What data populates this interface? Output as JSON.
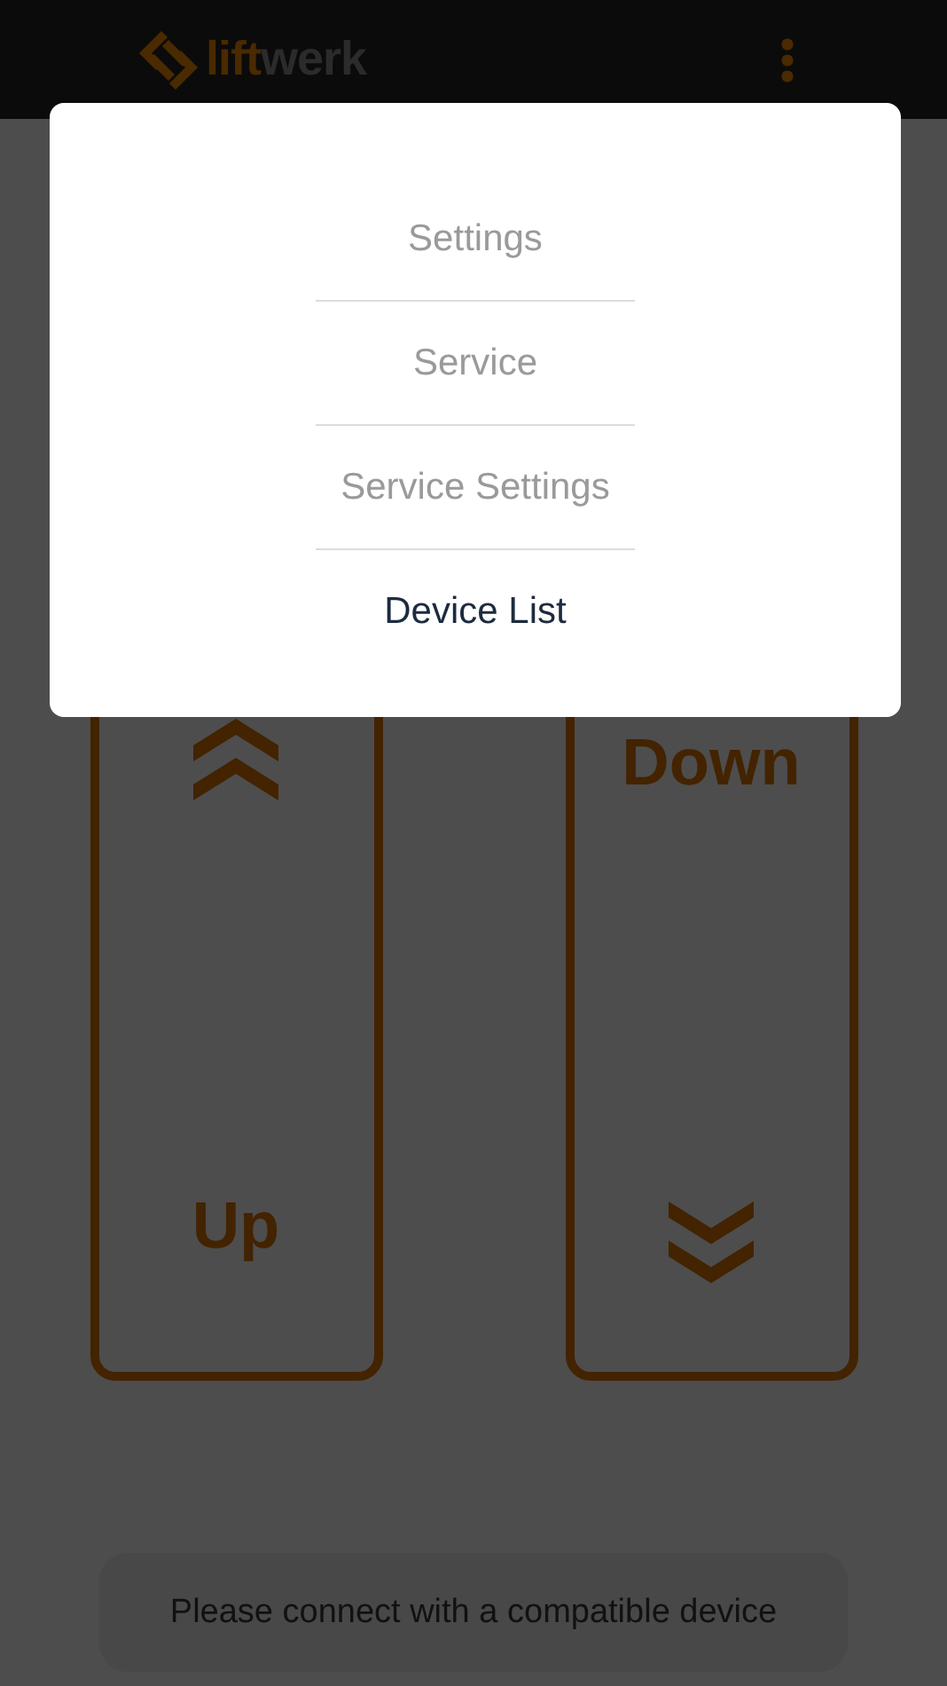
{
  "header": {
    "logo": [
      {
        "text": "lift",
        "accent": true
      },
      {
        "text": "werk",
        "accent": false
      }
    ]
  },
  "menu": {
    "items": [
      {
        "label": "Settings",
        "disabled": true
      },
      {
        "label": "Service",
        "disabled": true
      },
      {
        "label": "Service Settings",
        "disabled": true
      },
      {
        "label": "Device List",
        "disabled": false
      }
    ]
  },
  "controls": [
    {
      "kind": "up",
      "label": "Up"
    },
    {
      "kind": "down",
      "label": "Down"
    }
  ],
  "toast": "Please connect with a compatible device"
}
